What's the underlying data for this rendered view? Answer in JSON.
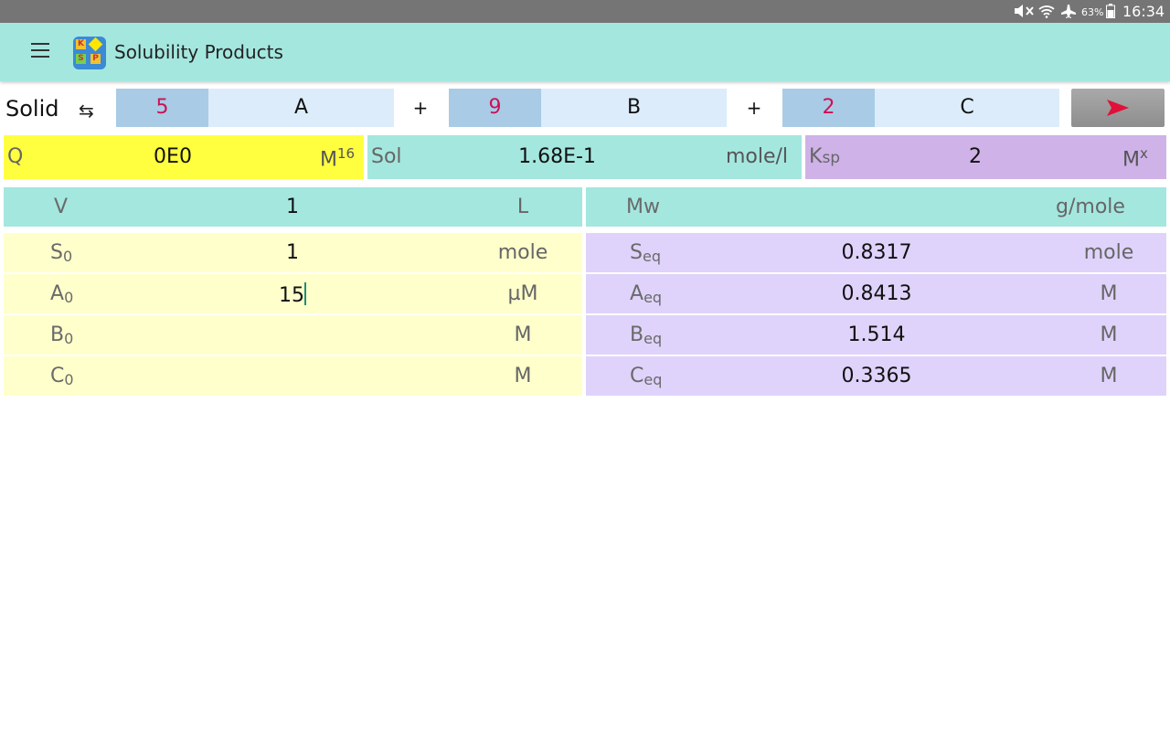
{
  "status_bar": {
    "icons": [
      "mute-icon",
      "wifi-icon",
      "airplane-mode-icon",
      "battery-icon"
    ],
    "battery_percent": "63%",
    "time": "16:34"
  },
  "app_bar": {
    "menu_icon": "hamburger-menu-icon",
    "title": "Solubility Products",
    "icon_letters": [
      "K",
      "S",
      "P"
    ]
  },
  "reaction": {
    "solid_label": "Solid",
    "arrow": "⇆",
    "terms": [
      {
        "coefficient": "5",
        "species": "A"
      },
      {
        "coefficient": "9",
        "species": "B"
      },
      {
        "coefficient": "2",
        "species": "C"
      }
    ],
    "plus": "+",
    "go_icon": "send-arrow-icon"
  },
  "summary": {
    "q": {
      "label": "Q",
      "value": "0E0",
      "unit": "M",
      "unit_sup": "16"
    },
    "sol": {
      "label": "Sol",
      "value": "1.68E-1",
      "unit": "mole/l"
    },
    "ksp": {
      "label": "K",
      "label_sub": "sp",
      "value": "2",
      "unit": "M",
      "unit_sup": "x"
    }
  },
  "volume_row": {
    "label": "V",
    "value": "1",
    "unit": "L"
  },
  "mw_row": {
    "label": "Mw",
    "value": "",
    "unit": "g/mole"
  },
  "initial": [
    {
      "label": "S",
      "sub": "0",
      "value": "1",
      "unit": "mole"
    },
    {
      "label": "A",
      "sub": "0",
      "value": "15",
      "unit": "µM"
    },
    {
      "label": "B",
      "sub": "0",
      "value": "",
      "unit": "M"
    },
    {
      "label": "C",
      "sub": "0",
      "value": "",
      "unit": "M"
    }
  ],
  "equilibrium": [
    {
      "label": "S",
      "sub": "eq",
      "value": "0.8317",
      "unit": "mole"
    },
    {
      "label": "A",
      "sub": "eq",
      "value": "0.8413",
      "unit": "M"
    },
    {
      "label": "B",
      "sub": "eq",
      "value": "1.514",
      "unit": "M"
    },
    {
      "label": "C",
      "sub": "eq",
      "value": "0.3365",
      "unit": "M"
    }
  ],
  "colors": {
    "app_bar": "#a4e7df",
    "q_box": "#ffff40",
    "sol_box": "#a4e7df",
    "ksp_box": "#cfb2e8",
    "initial_rows": "#ffffcc",
    "equilibrium_rows": "#dfd3fb",
    "coefficient_text": "#cc1155"
  }
}
